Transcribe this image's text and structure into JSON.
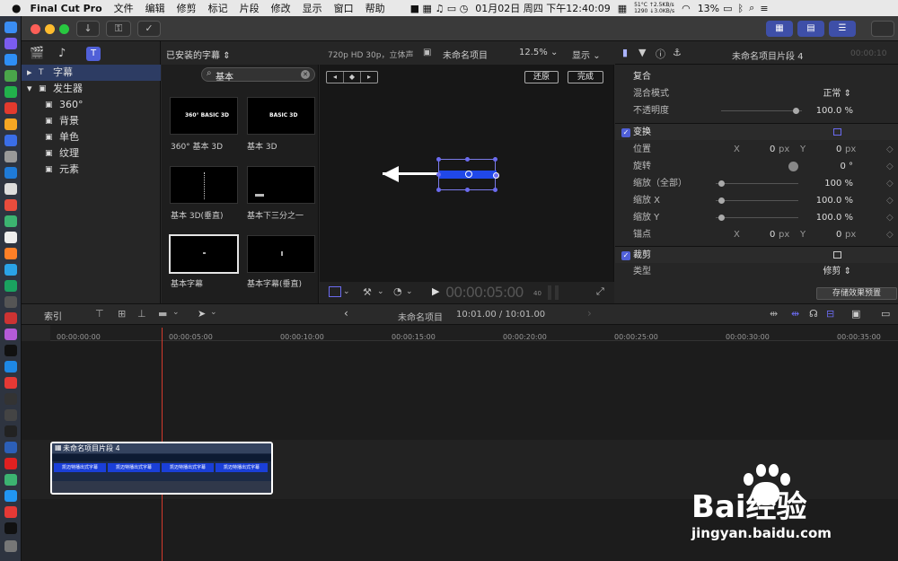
{
  "menubar": {
    "app": "Final Cut Pro",
    "items": [
      "文件",
      "编辑",
      "修剪",
      "标记",
      "片段",
      "修改",
      "显示",
      "窗口",
      "帮助"
    ],
    "temp": "51°C",
    "fan": "1290",
    "net_up": "↑2.5KB/s",
    "net_down": "↓3.0KB/s",
    "datetime": "01月02日 周四 下午12:40:09",
    "battery": "13%"
  },
  "library": {
    "items": [
      {
        "label": "字幕",
        "expanded": false,
        "selected": true
      },
      {
        "label": "发生器",
        "expanded": true,
        "selected": false
      },
      {
        "label": "360°"
      },
      {
        "label": "背景"
      },
      {
        "label": "单色"
      },
      {
        "label": "纹理"
      },
      {
        "label": "元素"
      }
    ]
  },
  "browser": {
    "filter": "已安装的字幕",
    "search_value": "基本",
    "thumbs": [
      {
        "label": "360° 基本 3D",
        "preview": "360° BASIC 3D"
      },
      {
        "label": "基本 3D",
        "preview": "BASIC 3D"
      },
      {
        "label": "基本 3D(垂直)",
        "preview": ""
      },
      {
        "label": "基本下三分之一",
        "preview": ""
      },
      {
        "label": "基本字幕",
        "preview": ""
      },
      {
        "label": "基本字幕(垂直)",
        "preview": ""
      }
    ]
  },
  "viewer": {
    "format": "720p HD 30p，立体声",
    "project": "未命名项目",
    "zoom": "12.5%",
    "display": "显示",
    "reset_label": "还原",
    "done_label": "完成",
    "timecode": "00:00:05:00",
    "timecode_frames": "40"
  },
  "inspector": {
    "clip_name": "未命名项目片段 4",
    "timecode_hint": "00:00:10",
    "composite": {
      "title": "复合",
      "blend_label": "混合模式",
      "blend_value": "正常",
      "opacity_label": "不透明度",
      "opacity_value": "100.0 %"
    },
    "transform": {
      "title": "变换",
      "position_label": "位置",
      "pos_x_label": "X",
      "pos_x": "0",
      "pos_y_label": "Y",
      "pos_y": "0",
      "unit": "px",
      "rotation_label": "旋转",
      "rotation_value": "0 °",
      "scale_all_label": "缩放（全部）",
      "scale_all": "100 %",
      "scale_x_label": "缩放 X",
      "scale_x": "100.0 %",
      "scale_y_label": "缩放 Y",
      "scale_y": "100.0 %",
      "anchor_label": "锚点",
      "anchor_x_label": "X",
      "anchor_x": "0",
      "anchor_y_label": "Y",
      "anchor_y": "0"
    },
    "crop": {
      "title": "裁剪",
      "type_label": "类型",
      "type_value": "修剪"
    },
    "save_preset": "存储效果预置"
  },
  "timeline": {
    "index_label": "索引",
    "project": "未命名项目",
    "duration": "10:01.00 / 10:01.00",
    "ticks": [
      "00:00:00:00",
      "00:00:05:00",
      "00:00:10:00",
      "00:00:15:00",
      "00:00:20:00",
      "00:00:25:00",
      "00:00:30:00",
      "00:00:35:00"
    ],
    "clip_name": "未命名项目片段 4",
    "segment_text": "凯迈特播出式字幕"
  },
  "watermark": {
    "brand": "Bai经验",
    "url": "jingyan.baidu.com"
  },
  "colors": {
    "accent": "#5060d8",
    "selection": "#2d3c63",
    "playhead": "#d33a2c"
  }
}
